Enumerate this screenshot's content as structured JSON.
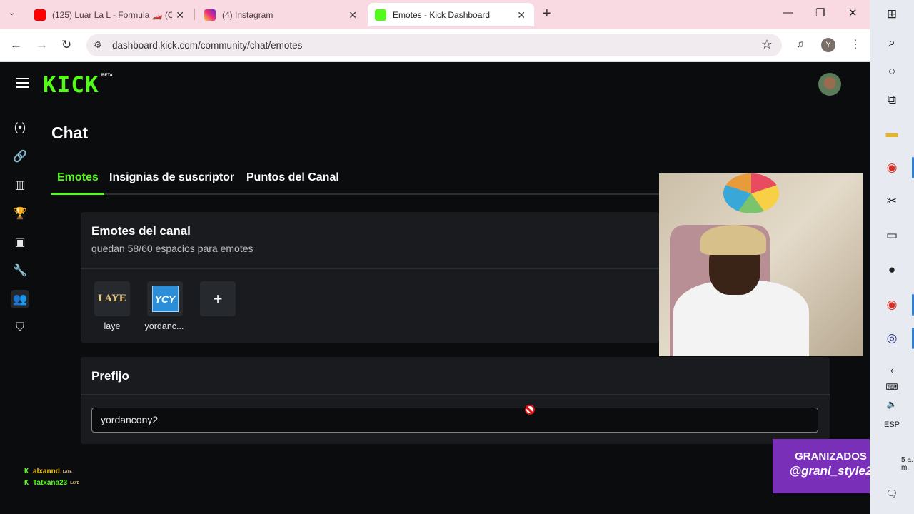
{
  "browser": {
    "tabs": [
      {
        "title": "(125) Luar La L - Formula 🏎️ (C",
        "favicon_color": "#ff0000"
      },
      {
        "title": "(4) Instagram",
        "favicon_color": "#d62976"
      },
      {
        "title": "Emotes - Kick Dashboard",
        "favicon_color": "#53fc18",
        "active": true
      }
    ],
    "tab_list_icon": "chevron-down-icon",
    "new_tab_icon": "+",
    "window_controls": {
      "minimize": "—",
      "restore": "❐",
      "close": "✕"
    },
    "url": "dashboard.kick.com/community/chat/emotes",
    "back": "←",
    "forward": "→",
    "reload": "↻",
    "site_info": "⚙",
    "star": "☆",
    "media": "♫",
    "profile_initial": "Y",
    "menu": "⋮"
  },
  "kick": {
    "logo": "KICK",
    "beta": "BETA",
    "sidebar_icons": [
      "live-icon",
      "link-icon",
      "analytics-icon",
      "trophy-icon",
      "video-icon",
      "wrench-icon",
      "community-icon",
      "moderation-icon"
    ],
    "page_title": "Chat",
    "tabs": [
      "Emotes",
      "Insignias de suscriptor",
      "Puntos del Canal"
    ],
    "emotes_card": {
      "title": "Emotes del canal",
      "subtitle": "quedan 58/60 espacios para emotes",
      "emotes": [
        {
          "name": "laye",
          "image_text": "LAYE"
        },
        {
          "name": "yordanc...",
          "image_text": "YCY"
        }
      ],
      "add_button": "+"
    },
    "prefix_card": {
      "title": "Prefijo",
      "input_value": "yordancony2"
    }
  },
  "chat_overlay": [
    {
      "user": "alxannd",
      "badge": "LAYE",
      "color": "#f0c419"
    },
    {
      "user": "Tatxana23",
      "badge": "LAYE",
      "color": "#53fc18"
    }
  ],
  "instagram_overlay": {
    "line1": "GRANIZADOS",
    "line2": "@grani_style2"
  },
  "taskbar": {
    "lang": "ESP",
    "time": "5 a. m."
  },
  "colors": {
    "kick_green": "#53fc18",
    "tab_strip": "#f9d9e2",
    "card_bg": "#191b1f"
  }
}
